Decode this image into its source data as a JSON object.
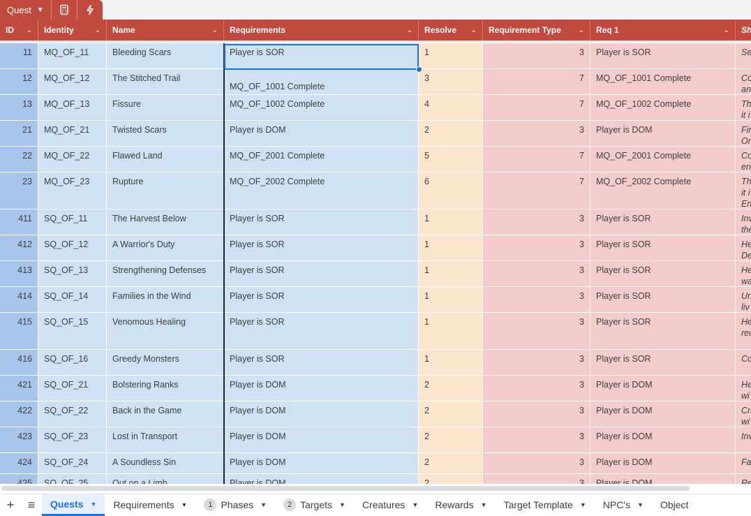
{
  "table_tab": {
    "name": "Quest"
  },
  "columns": [
    {
      "key": "id",
      "label": "ID"
    },
    {
      "key": "identity",
      "label": "Identity"
    },
    {
      "key": "name",
      "label": "Name"
    },
    {
      "key": "req",
      "label": "Requirements"
    },
    {
      "key": "resolve",
      "label": "Resolve"
    },
    {
      "key": "rtype",
      "label": "Requirement Type"
    },
    {
      "key": "req1",
      "label": "Req 1"
    },
    {
      "key": "sh",
      "label": "Sh"
    }
  ],
  "rows": [
    {
      "id": "11",
      "identity": "MQ_OF_11",
      "name": "Bleeding Scars",
      "req": "Player is SOR",
      "resolve": "1",
      "rtype": "3",
      "req1": "Player is SOR",
      "sh": "Se"
    },
    {
      "id": "12",
      "identity": "MQ_OF_12",
      "name": "The Stitched Trail",
      "req": "MQ_OF_1001 Complete",
      "resolve": "3",
      "rtype": "7",
      "req1": "MQ_OF_1001 Complete",
      "sh": "Co\nan"
    },
    {
      "id": "13",
      "identity": "MQ_OF_13",
      "name": "Fissure",
      "req": "MQ_OF_1002 Complete",
      "resolve": "4",
      "rtype": "7",
      "req1": "MQ_OF_1002 Complete",
      "sh": "Th\nit i"
    },
    {
      "id": "21",
      "identity": "MQ_OF_21",
      "name": "Twisted Scars",
      "req": "Player is DOM",
      "resolve": "2",
      "rtype": "3",
      "req1": "Player is DOM",
      "sh": "Fir\nOn"
    },
    {
      "id": "22",
      "identity": "MQ_OF_22",
      "name": "Flawed Land",
      "req": "MQ_OF_2001 Complete",
      "resolve": "5",
      "rtype": "7",
      "req1": "MQ_OF_2001 Complete",
      "sh": "Co\nen"
    },
    {
      "id": "23",
      "identity": "MQ_OF_23",
      "name": "Rupture",
      "req": "MQ_OF_2002 Complete",
      "resolve": "6",
      "rtype": "7",
      "req1": "MQ_OF_2002 Complete",
      "sh": "Th\nit i\nEn"
    },
    {
      "id": "411",
      "identity": "SQ_OF_11",
      "name": "The Harvest Below",
      "req": "Player is SOR",
      "resolve": "1",
      "rtype": "3",
      "req1": "Player is SOR",
      "sh": "Inv\nthe"
    },
    {
      "id": "412",
      "identity": "SQ_OF_12",
      "name": "A Warrior's Duty",
      "req": "Player is SOR",
      "resolve": "1",
      "rtype": "3",
      "req1": "Player is SOR",
      "sh": "He\nDe"
    },
    {
      "id": "413",
      "identity": "SQ_OF_13",
      "name": "Strengthening Defenses",
      "req": "Player is SOR",
      "resolve": "1",
      "rtype": "3",
      "req1": "Player is SOR",
      "sh": "He\nwa"
    },
    {
      "id": "414",
      "identity": "SQ_OF_14",
      "name": "Families in the Wind",
      "req": "Player is SOR",
      "resolve": "1",
      "rtype": "3",
      "req1": "Player is SOR",
      "sh": "Un\nliv"
    },
    {
      "id": "415",
      "identity": "SQ_OF_15",
      "name": "Venomous Healing",
      "req": "Player is SOR",
      "resolve": "1",
      "rtype": "3",
      "req1": "Player is SOR",
      "sh": "He\nrec"
    },
    {
      "id": "416",
      "identity": "SQ_OF_16",
      "name": "Greedy Monsters",
      "req": "Player is SOR",
      "resolve": "1",
      "rtype": "3",
      "req1": "Player is SOR",
      "sh": "Co"
    },
    {
      "id": "421",
      "identity": "SQ_OF_21",
      "name": "Bolstering Ranks",
      "req": "Player is DOM",
      "resolve": "2",
      "rtype": "3",
      "req1": "Player is DOM",
      "sh": "He\nwi"
    },
    {
      "id": "422",
      "identity": "SQ_OF_22",
      "name": "Back in the Game",
      "req": "Player is DOM",
      "resolve": "2",
      "rtype": "3",
      "req1": "Player is DOM",
      "sh": "Cra\nwi"
    },
    {
      "id": "423",
      "identity": "SQ_OF_23",
      "name": "Lost in Transport",
      "req": "Player is DOM",
      "resolve": "2",
      "rtype": "3",
      "req1": "Player is DOM",
      "sh": "Inv"
    },
    {
      "id": "424",
      "identity": "SQ_OF_24",
      "name": "A Soundless Sin",
      "req": "Player is DOM",
      "resolve": "2",
      "rtype": "3",
      "req1": "Player is DOM",
      "sh": "Fa"
    },
    {
      "id": "425",
      "identity": "SQ_OF_25",
      "name": "Out on a Limb",
      "req": "Player is DOM",
      "resolve": "2",
      "rtype": "3",
      "req1": "Player is DOM",
      "sh": "Re"
    }
  ],
  "sheet_tabs": [
    {
      "label": "Quests",
      "active": true,
      "badge": ""
    },
    {
      "label": "Requirements",
      "active": false,
      "badge": ""
    },
    {
      "label": "Phases",
      "active": false,
      "badge": "1"
    },
    {
      "label": "Targets",
      "active": false,
      "badge": "2"
    },
    {
      "label": "Creatures",
      "active": false,
      "badge": ""
    },
    {
      "label": "Rewards",
      "active": false,
      "badge": ""
    },
    {
      "label": "Target Template",
      "active": false,
      "badge": ""
    },
    {
      "label": "NPC's",
      "active": false,
      "badge": ""
    },
    {
      "label": "Object",
      "active": false,
      "badge": ""
    }
  ],
  "icons": {
    "add": "plus-icon",
    "all_sheets": "menu-icon",
    "calc": "calculator-icon",
    "automation": "lightning-icon"
  },
  "colors": {
    "header": "#c14a3f",
    "id_col": "#a9c4ea",
    "blue_cols": "#cfe2f3",
    "resolve_col": "#fce5cd",
    "red_cols": "#f4cccc",
    "accent": "#1a73e8"
  }
}
